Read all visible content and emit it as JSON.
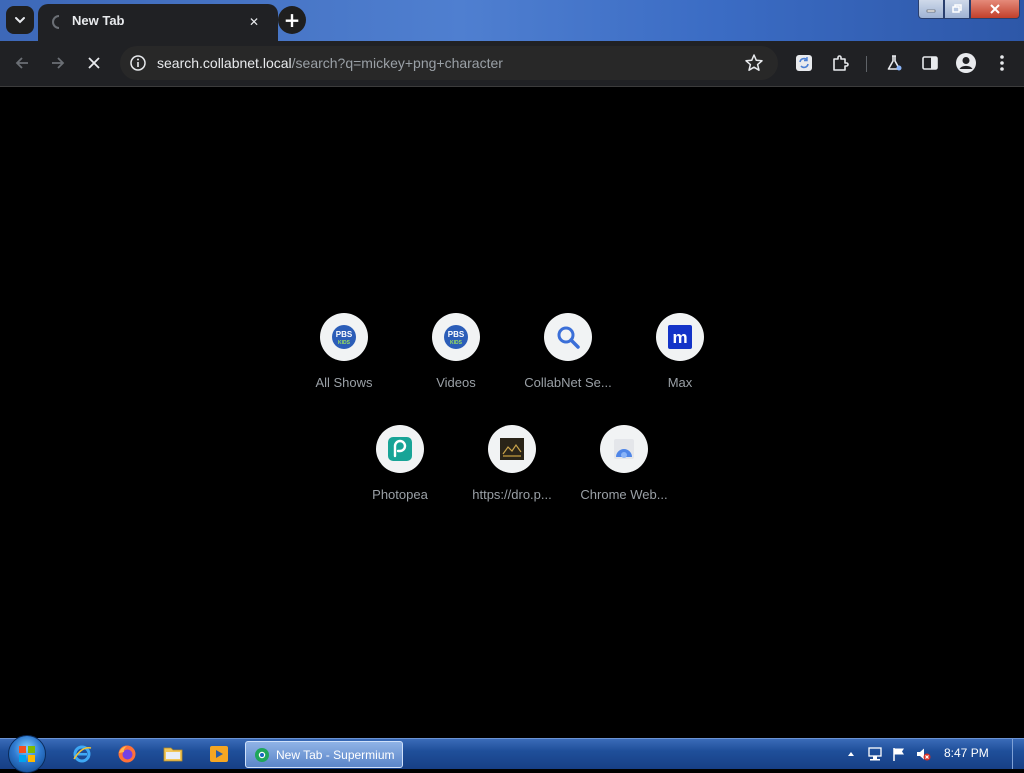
{
  "browser": {
    "tab": {
      "title": "New Tab",
      "close_glyph": "✕"
    },
    "new_tab_glyph": "+",
    "omnibox": {
      "host": "search.collabnet.local",
      "path": "/search?q=mickey+png+character"
    },
    "colors": {
      "toolbar": "#202124",
      "omnibox": "#282828",
      "accent": "#8ab4f8"
    }
  },
  "shortcuts": [
    {
      "label": "All Shows",
      "icon": "pbs-kids-icon"
    },
    {
      "label": "Videos",
      "icon": "pbs-kids-icon"
    },
    {
      "label": "CollabNet Se...",
      "icon": "search-icon"
    },
    {
      "label": "Max",
      "icon": "max-m-icon"
    },
    {
      "label": "Photopea",
      "icon": "photopea-icon"
    },
    {
      "label": "https://dro.p...",
      "icon": "dro-thumbnail-icon"
    },
    {
      "label": "Chrome Web...",
      "icon": "chrome-web-store-icon"
    }
  ],
  "pbs_badge": {
    "line1": "PBS",
    "line2": "KIDS"
  },
  "max_letter": "m",
  "taskbar": {
    "active_window": "New Tab - Supermium",
    "clock": "8:47 PM"
  }
}
